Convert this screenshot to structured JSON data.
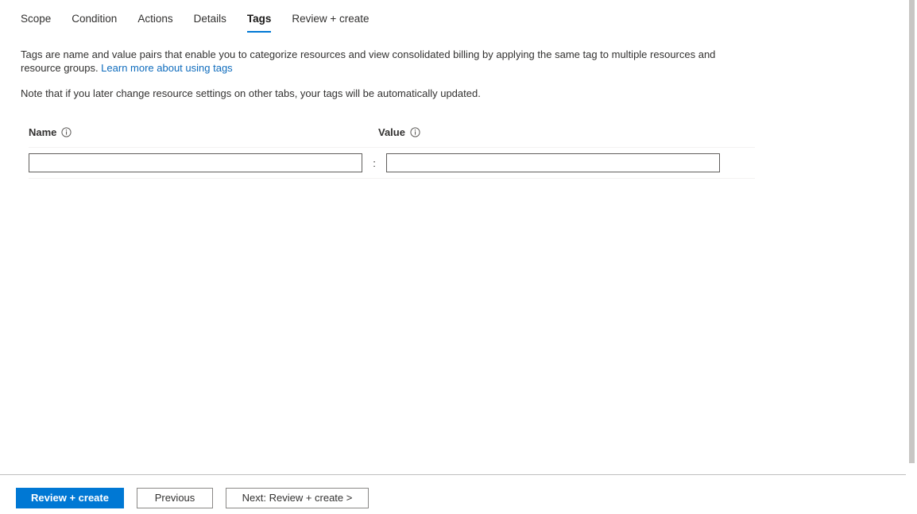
{
  "tabs": [
    {
      "label": "Scope",
      "active": false
    },
    {
      "label": "Condition",
      "active": false
    },
    {
      "label": "Actions",
      "active": false
    },
    {
      "label": "Details",
      "active": false
    },
    {
      "label": "Tags",
      "active": true
    },
    {
      "label": "Review + create",
      "active": false
    }
  ],
  "description": {
    "text_before_link": "Tags are name and value pairs that enable you to categorize resources and view consolidated billing by applying the same tag to multiple resources and resource groups. ",
    "link_label": "Learn more about using tags",
    "note": "Note that if you later change resource settings on other tabs, your tags will be automatically updated."
  },
  "tag_grid": {
    "name_column_header": "Name",
    "value_column_header": "Value",
    "separator": ":",
    "rows": [
      {
        "name_value": "",
        "name_placeholder": "",
        "value_value": "",
        "value_placeholder": ""
      }
    ]
  },
  "footer": {
    "primary_button": "Review + create",
    "previous_button": "Previous",
    "next_button": "Next: Review + create >"
  },
  "colors": {
    "accent": "#0078d4",
    "link": "#0f6cbd",
    "text": "#323130",
    "border": "#605e5c",
    "divider": "#f3f2f1",
    "scrollbar_thumb": "#c8c6c4"
  }
}
